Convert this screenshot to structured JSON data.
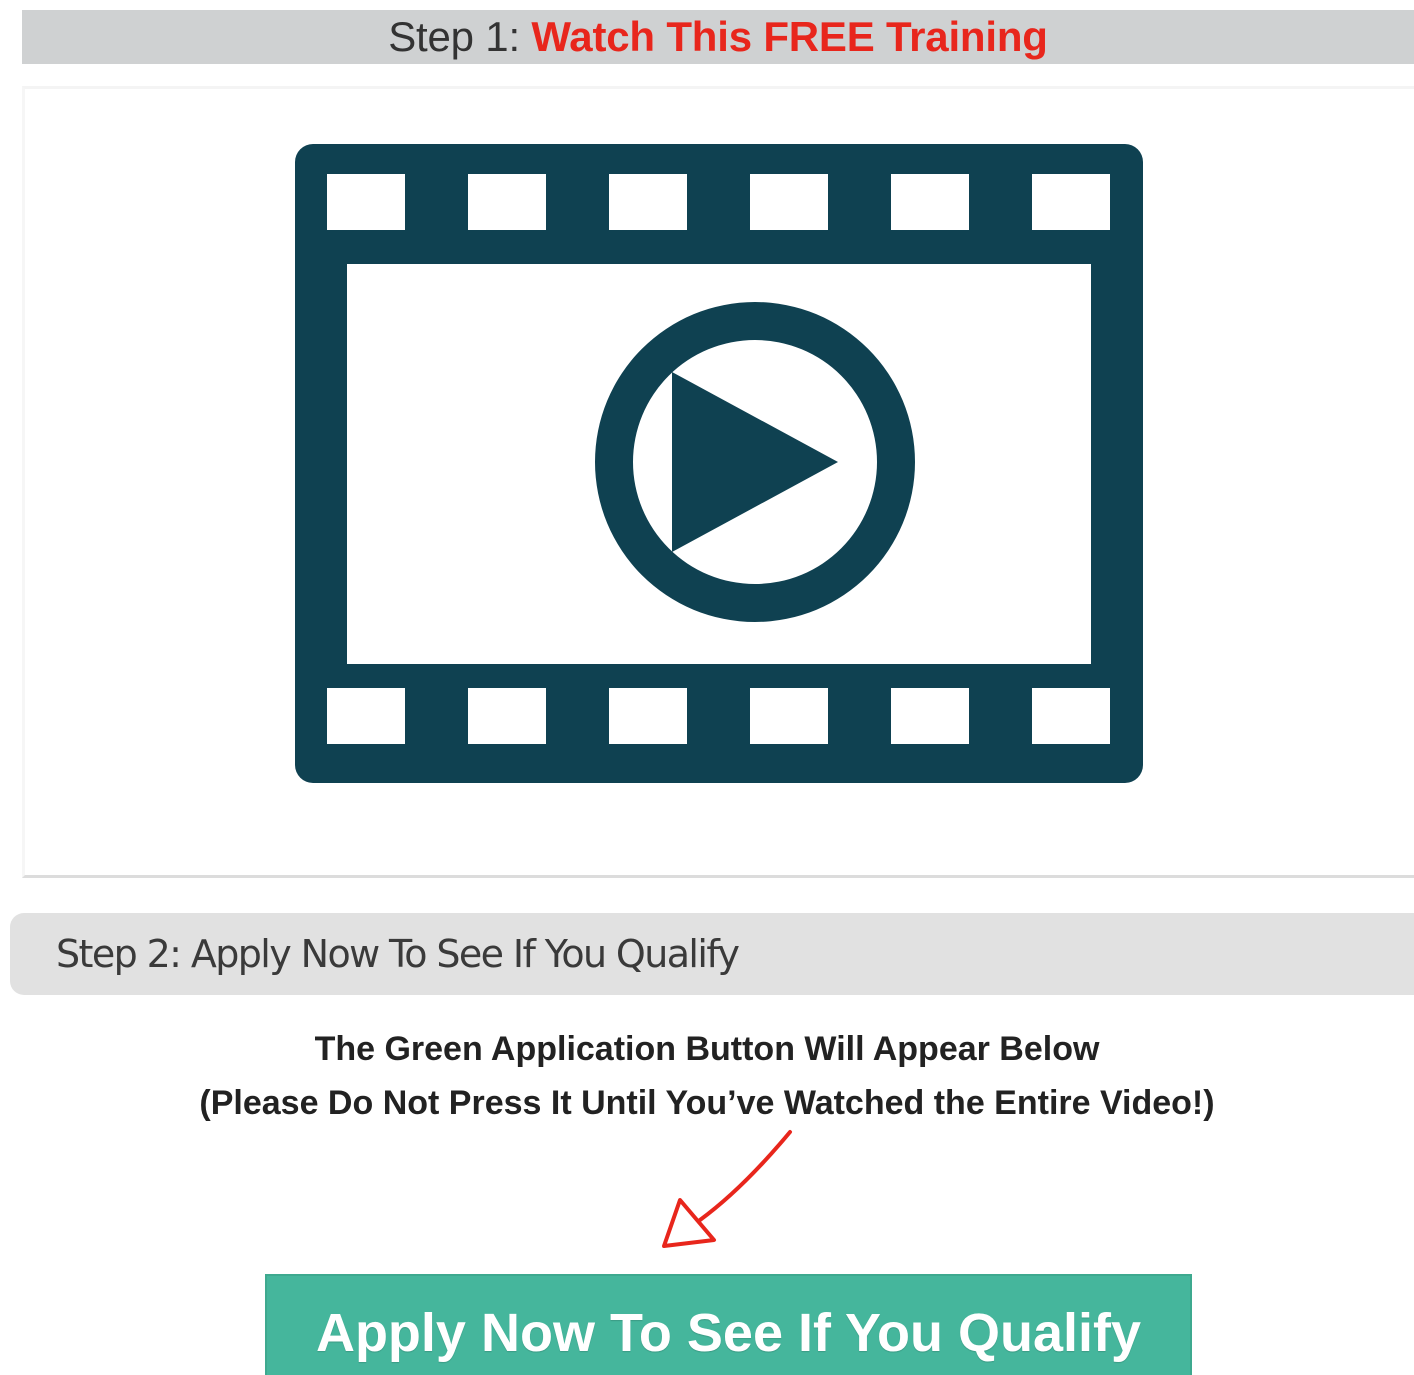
{
  "step1": {
    "prefix": "Step 1:",
    "highlight": "Watch This FREE Training",
    "highlight_color": "#e8261c"
  },
  "video": {
    "icon": "film-strip-play-icon",
    "color": "#0f4151"
  },
  "step2": {
    "label": "Step 2: Apply Now To See If You Qualify"
  },
  "notice": {
    "line1": "The Green Application Button Will Appear Below",
    "line2": "(Please Do Not Press It Until You’ve Watched the Entire Video!)"
  },
  "arrow": {
    "icon": "red-arrow-down-left-icon",
    "color": "#e8261c"
  },
  "apply_button": {
    "label": "Apply Now To See If You Qualify",
    "color": "#45b69c"
  }
}
